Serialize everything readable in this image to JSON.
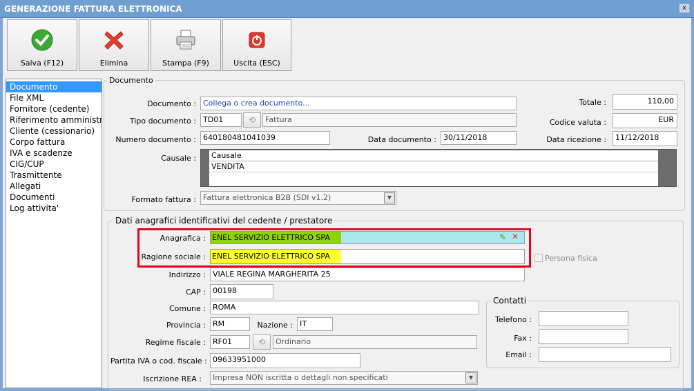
{
  "window": {
    "title": "GENERAZIONE FATTURA ELETTRONICA",
    "close": "x"
  },
  "toolbar": {
    "save": "Salva (F12)",
    "delete": "Elimina",
    "print": "Stampa (F9)",
    "exit": "Uscita (ESC)"
  },
  "sidebar": {
    "items": [
      {
        "label": "Documento"
      },
      {
        "label": "File XML"
      },
      {
        "label": "Fornitore (cedente)"
      },
      {
        "label": "Riferimento amministrativo"
      },
      {
        "label": "Cliente (cessionario)"
      },
      {
        "label": "Corpo fattura"
      },
      {
        "label": "IVA e scadenze"
      },
      {
        "label": "CIG/CUP"
      },
      {
        "label": "Trasmittente"
      },
      {
        "label": "Allegati"
      },
      {
        "label": "Documenti"
      },
      {
        "label": "Log attivita'"
      }
    ]
  },
  "documento": {
    "group_label": "Documento",
    "documento_label": "Documento :",
    "documento_link": "Collega o crea documento...",
    "tipo_label": "Tipo documento :",
    "tipo_code": "TD01",
    "tipo_desc": "Fattura",
    "numero_label": "Numero documento :",
    "numero_value": "640180481041039",
    "data_label": "Data documento :",
    "data_value": "30/11/2018",
    "causale_label": "Causale :",
    "causale_header": "Causale",
    "causale_row": "VENDITA",
    "formato_label": "Formato fattura :",
    "formato_value": "Fattura elettronica B2B (SDI v1.2)",
    "totale_label": "Totale :",
    "totale_value": "110,00",
    "valuta_label": "Codice valuta :",
    "valuta_value": "EUR",
    "ricezione_label": "Data ricezione :",
    "ricezione_value": "11/12/2018"
  },
  "cedente": {
    "group_label": "Dati anagrafici identificativi del cedente / prestatore",
    "anagrafica_label": "Anagrafica :",
    "anagrafica_value": "ENEL SERVIZIO ELETTRICO SPA",
    "ragione_label": "Ragione sociale :",
    "ragione_value": "ENEL SERVIZIO ELETTRICO SPA",
    "persona_fisica": "Persona fisica",
    "indirizzo_label": "Indirizzo :",
    "indirizzo_value": "VIALE REGINA MARGHERITA 25",
    "cap_label": "CAP :",
    "cap_value": "00198",
    "comune_label": "Comune :",
    "comune_value": "ROMA",
    "provincia_label": "Provincia :",
    "provincia_value": "RM",
    "nazione_label": "Nazione :",
    "nazione_value": "IT",
    "regime_label": "Regime fiscale :",
    "regime_code": "RF01",
    "regime_desc": "Ordinario",
    "piva_label": "Partita IVA o cod. fiscale :",
    "piva_value": "09633951000",
    "rea_label": "Iscrizione REA :",
    "rea_value": "Impresa NON iscritta o dettagli non specificati"
  },
  "contatti": {
    "group_label": "Contatti",
    "telefono_label": "Telefono :",
    "fax_label": "Fax :",
    "email_label": "Email :"
  },
  "colors": {
    "highlight_border": "#e8001c",
    "anagrafica_bg": "#a8e8ee",
    "anagrafica_text_bg": "#8fd400",
    "ragione_bg": "#ffff33",
    "selection": "#3399ff"
  }
}
